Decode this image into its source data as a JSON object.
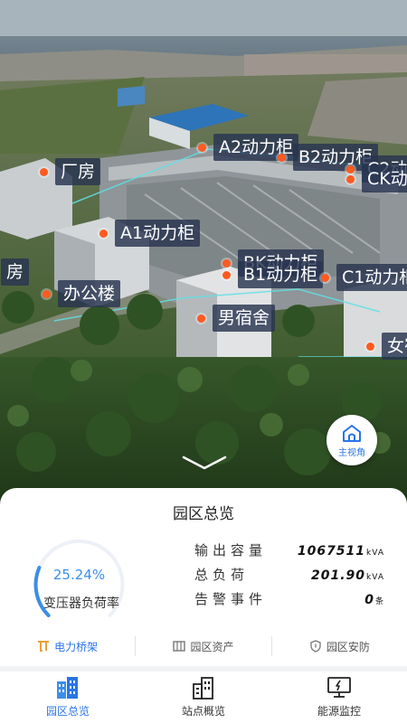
{
  "map": {
    "markers": [
      {
        "name": "marker-factory",
        "label": "厂房"
      },
      {
        "name": "marker-a2-cabinet",
        "label": "A2动力柜"
      },
      {
        "name": "marker-b2-cabinet",
        "label": "B2动力柜"
      },
      {
        "name": "marker-c2-cabinet",
        "label": "C2动"
      },
      {
        "name": "marker-ck-cabinet",
        "label": "CK动"
      },
      {
        "name": "marker-a1-cabinet",
        "label": "A1动力柜"
      },
      {
        "name": "marker-factory-left",
        "label": "房"
      },
      {
        "name": "marker-office",
        "label": "办公楼"
      },
      {
        "name": "marker-bk-cabinet",
        "label": "BK动力柜"
      },
      {
        "name": "marker-b1-cabinet",
        "label": "B1动力柜"
      },
      {
        "name": "marker-c1-cabinet",
        "label": "C1动力柜"
      },
      {
        "name": "marker-male-dorm",
        "label": "男宿舍"
      },
      {
        "name": "marker-female-dorm",
        "label": "女宿"
      }
    ],
    "home_view_label": "主视角"
  },
  "panel": {
    "title": "园区总览",
    "gauge": {
      "value_text": "25.24%",
      "fraction": 0.2524,
      "caption": "变压器负荷率"
    },
    "stats": [
      {
        "label": "输出容量",
        "value": "1067511",
        "unit": "kVA"
      },
      {
        "label": "总负荷",
        "value": "201.90",
        "unit": "kVA"
      },
      {
        "label": "告警事件",
        "value": "0",
        "unit": "条"
      }
    ],
    "subtabs": [
      {
        "label": "电力桥架",
        "icon": "cable-tray-icon"
      },
      {
        "label": "园区资产",
        "icon": "assets-icon"
      },
      {
        "label": "园区安防",
        "icon": "shield-icon"
      }
    ]
  },
  "nav": {
    "items": [
      {
        "label": "园区总览",
        "icon": "buildings-icon"
      },
      {
        "label": "站点概览",
        "icon": "site-building-icon"
      },
      {
        "label": "能源监控",
        "icon": "monitor-icon"
      }
    ]
  },
  "colors": {
    "accent": "#2a74e6",
    "marker_dot": "#ff5a1f",
    "label_bg": "#283450"
  }
}
